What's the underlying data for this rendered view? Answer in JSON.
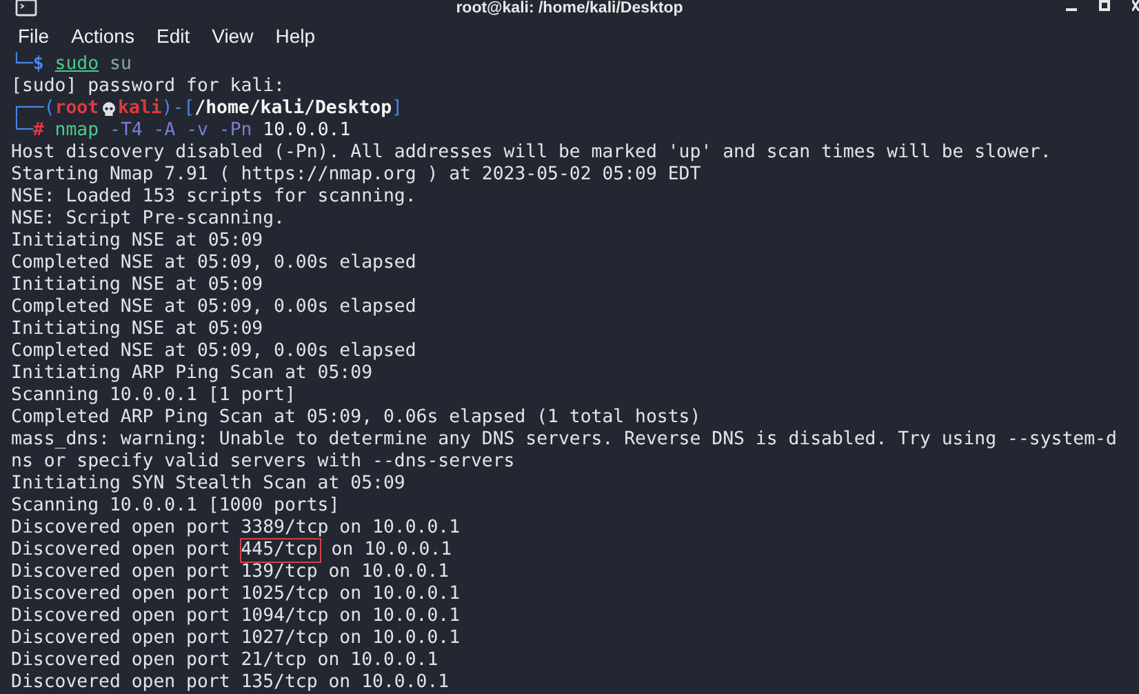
{
  "window": {
    "title": "root@kali: /home/kali/Desktop"
  },
  "menu": [
    "File",
    "Actions",
    "Edit",
    "View",
    "Help"
  ],
  "lines": [
    {
      "kind": "command",
      "corner": "└─",
      "sigil": "$",
      "command": "sudo",
      "args": "su"
    },
    {
      "kind": "output",
      "text": "[sudo] password for kali:"
    },
    {
      "kind": "prompt_head",
      "open": "┌──(",
      "user": "root",
      "host": "kali",
      "mid": ")-[",
      "path": "/home/kali/Desktop",
      "close": "]"
    },
    {
      "kind": "command",
      "corner": "└─",
      "sigil": "#",
      "command": "nmap",
      "args": "-T4 -A -v -Pn",
      "target": "10.0.0.1"
    },
    {
      "kind": "output",
      "text": "Host discovery disabled (-Pn). All addresses will be marked 'up' and scan times will be slower."
    },
    {
      "kind": "output",
      "text": "Starting Nmap 7.91 ( https://nmap.org ) at 2023-05-02 05:09 EDT"
    },
    {
      "kind": "output",
      "text": "NSE: Loaded 153 scripts for scanning."
    },
    {
      "kind": "output",
      "text": "NSE: Script Pre-scanning."
    },
    {
      "kind": "output",
      "text": "Initiating NSE at 05:09"
    },
    {
      "kind": "output",
      "text": "Completed NSE at 05:09, 0.00s elapsed"
    },
    {
      "kind": "output",
      "text": "Initiating NSE at 05:09"
    },
    {
      "kind": "output",
      "text": "Completed NSE at 05:09, 0.00s elapsed"
    },
    {
      "kind": "output",
      "text": "Initiating NSE at 05:09"
    },
    {
      "kind": "output",
      "text": "Completed NSE at 05:09, 0.00s elapsed"
    },
    {
      "kind": "output",
      "text": "Initiating ARP Ping Scan at 05:09"
    },
    {
      "kind": "output",
      "text": "Scanning 10.0.0.1 [1 port]"
    },
    {
      "kind": "output",
      "text": "Completed ARP Ping Scan at 05:09, 0.06s elapsed (1 total hosts)"
    },
    {
      "kind": "output",
      "text": "mass_dns: warning: Unable to determine any DNS servers. Reverse DNS is disabled. Try using --system-d"
    },
    {
      "kind": "output",
      "text": "ns or specify valid servers with --dns-servers"
    },
    {
      "kind": "output",
      "text": "Initiating SYN Stealth Scan at 05:09"
    },
    {
      "kind": "output",
      "text": "Scanning 10.0.0.1 [1000 ports]"
    },
    {
      "kind": "output",
      "text": "Discovered open port 3389/tcp on 10.0.0.1"
    },
    {
      "kind": "boxed",
      "before": "Discovered open port ",
      "boxed": "445/tcp",
      "after": " on 10.0.0.1"
    },
    {
      "kind": "output",
      "text": "Discovered open port 139/tcp on 10.0.0.1"
    },
    {
      "kind": "output",
      "text": "Discovered open port 1025/tcp on 10.0.0.1"
    },
    {
      "kind": "output",
      "text": "Discovered open port 1094/tcp on 10.0.0.1"
    },
    {
      "kind": "output",
      "text": "Discovered open port 1027/tcp on 10.0.0.1"
    },
    {
      "kind": "output",
      "text": "Discovered open port 21/tcp on 10.0.0.1"
    },
    {
      "kind": "output",
      "text": "Discovered open port 135/tcp on 10.0.0.1"
    }
  ]
}
